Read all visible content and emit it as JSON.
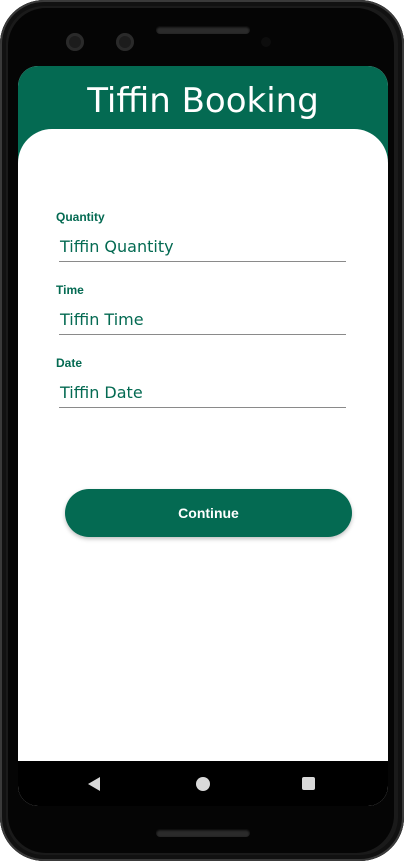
{
  "app": {
    "title": "Tiffin Booking"
  },
  "form": {
    "quantity": {
      "label": "Quantity",
      "placeholder": "Tiffin Quantity"
    },
    "time": {
      "label": "Time",
      "placeholder": "Tiffin Time"
    },
    "date": {
      "label": "Date",
      "placeholder": "Tiffin Date"
    },
    "continue_label": "Continue"
  },
  "navbar": {
    "back_icon": "back-triangle-icon",
    "home_icon": "home-circle-icon",
    "recents_icon": "recents-square-icon"
  },
  "colors": {
    "primary": "#046a52",
    "background": "#ffffff",
    "navbar": "#000000"
  }
}
